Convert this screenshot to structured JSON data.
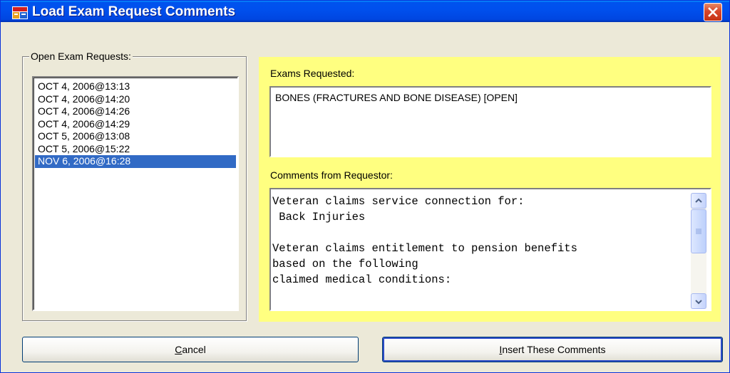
{
  "window": {
    "title": "Load Exam Request Comments",
    "icon": "vista-app-icon",
    "titlebar_color": "#0050ee",
    "close_icon": "close-icon"
  },
  "open_exam_requests": {
    "label": "Open Exam Requests:",
    "items": [
      "OCT  4, 2006@13:13",
      "OCT  4, 2006@14:20",
      "OCT  4, 2006@14:26",
      "OCT  4, 2006@14:29",
      "OCT  5, 2006@13:08",
      "OCT  5, 2006@15:22",
      "NOV  6, 2006@16:28"
    ],
    "selected_index": 6,
    "selection_color": "#316ac5"
  },
  "details": {
    "panel_color": "#ffff80",
    "exams_label": "Exams Requested:",
    "exams_value": "BONES (FRACTURES AND BONE DISEASE) [OPEN]",
    "comments_label": "Comments from Requestor:",
    "comments_lines": [
      "Veteran claims service connection for:",
      " Back Injuries",
      "",
      "Veteran claims entitlement to pension benefits",
      "based on the following",
      "claimed medical conditions:"
    ]
  },
  "buttons": {
    "cancel_label": "Cancel",
    "cancel_accel": "C",
    "insert_label": "Insert These Comments",
    "insert_accel": "I"
  }
}
